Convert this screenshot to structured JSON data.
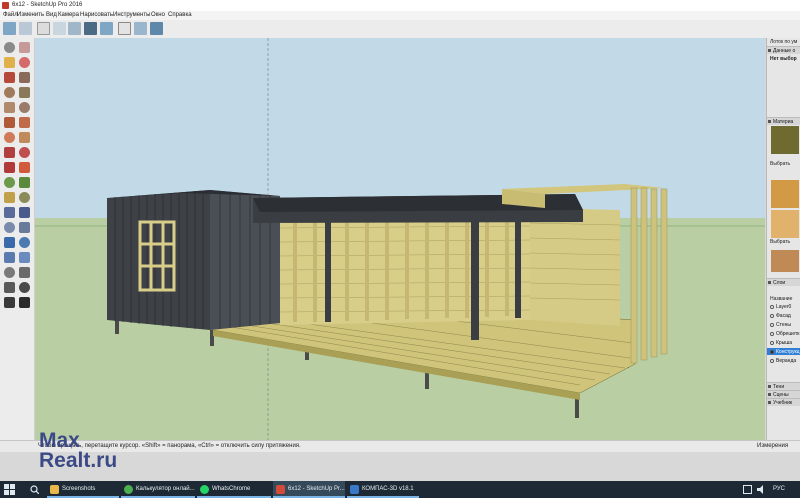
{
  "window": {
    "title": "6x12 - SketchUp Pro 2016"
  },
  "menu": [
    "Файл",
    "Изменить",
    "Вид",
    "Камера",
    "Нарисовать",
    "Инструменты",
    "Окно",
    "Справка"
  ],
  "toolbar": {
    "icons": [
      "cube-iso-icon",
      "cube-outline-icon",
      "cube-top-icon",
      "cube-front-icon",
      "cube-right-icon",
      "cube-back-icon",
      "cube-left-icon",
      "style-xray-icon",
      "style-shaded-icon",
      "section-plane-icon",
      "section-cut-icon"
    ]
  },
  "left_tools": {
    "icons": [
      "select-arrow-icon",
      "eraser-icon",
      "paint-bucket-icon",
      "eraser2-icon",
      "line-pencil-icon",
      "freehand-icon",
      "rectangle-icon",
      "rotated-rect-icon",
      "circle-icon",
      "polygon-icon",
      "arc-icon",
      "arc2-icon",
      "pie-icon",
      "arc3-icon",
      "move-icon",
      "push-pull-icon",
      "rotate-icon",
      "follow-me-icon",
      "scale-icon",
      "offset-icon",
      "tape-measure-icon",
      "dimension-icon",
      "protractor-icon",
      "text-icon",
      "axes-icon",
      "3d-text-icon",
      "orbit-icon",
      "pan-icon",
      "zoom-icon",
      "zoom-window-icon",
      "zoom-extents-icon",
      "previous-view-icon",
      "position-camera-icon",
      "look-around-icon",
      "walk-icon",
      "section-icon"
    ]
  },
  "right_panel": {
    "tray_title": "Лоток по ум",
    "entity_info": {
      "header": "Данные о",
      "value": "Нет выбор"
    },
    "materials": {
      "header": "Материа",
      "select_label": "Выбрать",
      "select_label2": "Выбрать"
    },
    "layers": {
      "header": "Слои",
      "column": "Название",
      "items": [
        {
          "name": "Layer0",
          "active": false
        },
        {
          "name": "Фасад",
          "active": false
        },
        {
          "name": "Стены",
          "active": false
        },
        {
          "name": "Обрешетк",
          "active": false
        },
        {
          "name": "Крыша",
          "active": false
        },
        {
          "name": "Конструкц",
          "active": true
        },
        {
          "name": "Веранда",
          "active": false
        }
      ]
    },
    "collapsed": [
      "Тени",
      "Сцены",
      "Учебник"
    ]
  },
  "status": {
    "hint": "Чтобы вращать, перетащите курсор. «Shift» = панорама, «Ctrl» = отключить силу притяжения.",
    "measurements_label": "Измерения"
  },
  "taskbar": {
    "items": [
      {
        "label": "Screenshots",
        "icon": "folder-icon",
        "color": "#e8b84a",
        "active": false
      },
      {
        "label": "Калькулятор онлай...",
        "icon": "chrome-icon",
        "color": "#4caf50",
        "active": false
      },
      {
        "label": "WhatsChrome",
        "icon": "whatsapp-icon",
        "color": "#25d366",
        "active": false
      },
      {
        "label": "6x12 - SketchUp Pr...",
        "icon": "sketchup-icon",
        "color": "#d24a3a",
        "active": true
      },
      {
        "label": "КОМПАС-3D v18.1",
        "icon": "kompas-icon",
        "color": "#3a78c8",
        "active": false
      }
    ],
    "tray_lang": "РУС"
  },
  "watermark": {
    "line1": "Max",
    "line2": "Realt.ru"
  },
  "colors": {
    "sky": "#c2dae8",
    "ground": "#b9cfa3",
    "wood_light": "#d8ce8a",
    "wood_dark": "#3e4247",
    "accent_blue": "#78b4e6",
    "watermark": "#3b4a86"
  }
}
